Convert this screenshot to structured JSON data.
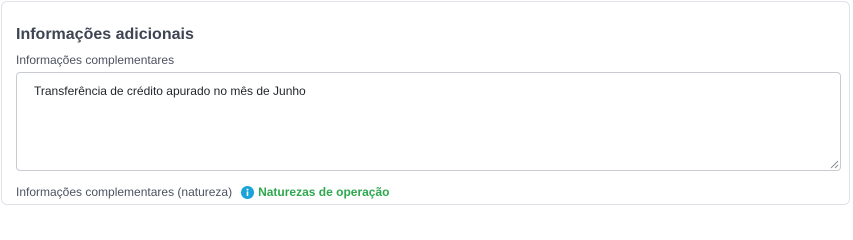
{
  "section": {
    "title": "Informações adicionais"
  },
  "complementares": {
    "label": "Informações complementares",
    "value": "Transferência de crédito apurado no mês de Junho"
  },
  "natureza": {
    "label": "Informações complementares (natureza)",
    "info_icon": "info-circle-icon",
    "link_text": "Naturezas de operação"
  },
  "colors": {
    "link_green": "#2fa84f",
    "info_blue": "#1aa3d9",
    "border": "#c8ccd2"
  }
}
